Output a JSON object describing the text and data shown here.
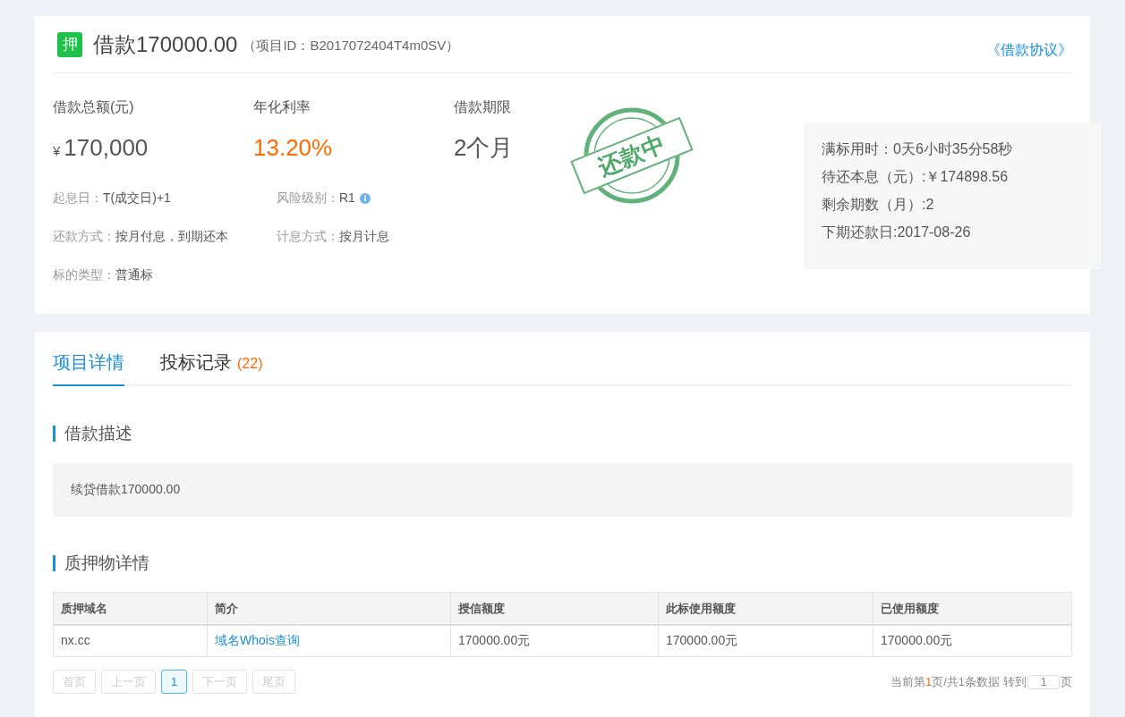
{
  "header": {
    "badge": "押",
    "title": "借款170000.00",
    "project_id": "（项目ID：B2017072404T4m0SV）",
    "agreement_link": "《借款协议》"
  },
  "stats": [
    {
      "label": "借款总额(元)",
      "currency": "¥",
      "value": "170,000",
      "kind": "money"
    },
    {
      "label": "年化利率",
      "value": "13.20%",
      "kind": "rate"
    },
    {
      "label": "借款期限",
      "value": "2个月",
      "kind": "plain"
    }
  ],
  "details": [
    {
      "label": "起息日：",
      "value": "T(成交日)+1",
      "info": false
    },
    {
      "label": "风险级别：",
      "value": "R1",
      "info": true
    },
    {
      "label": "还款方式：",
      "value": "按月付息，到期还本",
      "info": false
    },
    {
      "label": "计息方式：",
      "value": "按月计息",
      "info": false
    },
    {
      "label": "标的类型：",
      "value": "普通标",
      "info": false
    }
  ],
  "stamp": "还款中",
  "summary": [
    "满标用时：0天6小时35分58秒",
    "待还本息（元）:￥174898.56",
    "剩余期数（月）:2",
    "下期还款日:2017-08-26"
  ],
  "tabs": [
    {
      "label": "项目详情",
      "selected": true
    },
    {
      "label": "投标记录",
      "count": "(22)",
      "selected": false
    }
  ],
  "description": {
    "heading": "借款描述",
    "text": "续贷借款170000.00"
  },
  "collateral": {
    "heading": "质押物详情",
    "columns": [
      "质押域名",
      "简介",
      "授信额度",
      "此标使用额度",
      "已使用额度"
    ],
    "rows": [
      {
        "domain": "nx.cc",
        "intro_link": "域名Whois查询",
        "credit": "170000.00元",
        "used_this": "170000.00元",
        "used_total": "170000.00元"
      }
    ]
  },
  "pagination": {
    "buttons": [
      {
        "label": "首页",
        "selected": false,
        "disabled": true
      },
      {
        "label": "上一页",
        "selected": false,
        "disabled": true
      },
      {
        "label": "1",
        "selected": true,
        "disabled": false
      },
      {
        "label": "下一页",
        "selected": false,
        "disabled": true
      },
      {
        "label": "尾页",
        "selected": false,
        "disabled": true
      }
    ],
    "summary_prefix": "当前第",
    "current_page": "1",
    "summary_suffix": "页/共1条数据",
    "goto_label": "转到",
    "goto_value": "1",
    "goto_unit": "页"
  }
}
